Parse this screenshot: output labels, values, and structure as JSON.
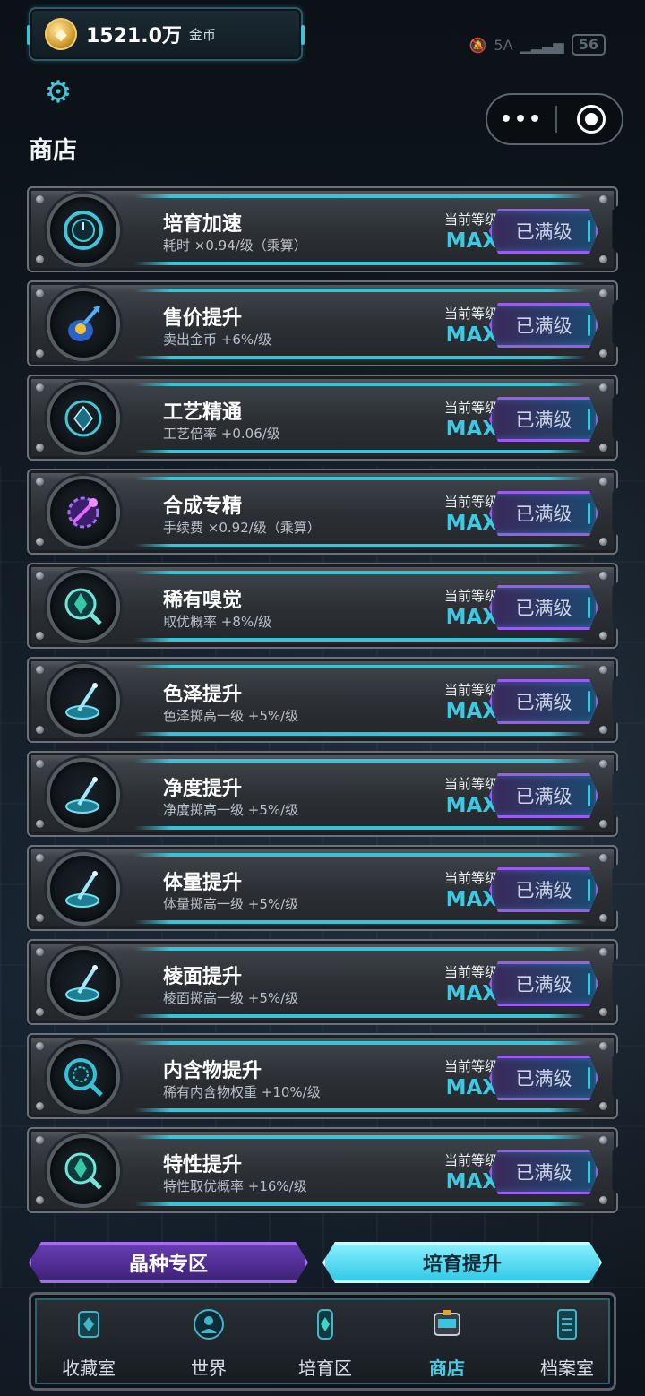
{
  "status_bar": {
    "coin_amount": "1521.0万",
    "coin_unit": "金币",
    "signal_label": "5A",
    "battery": "56"
  },
  "header": {
    "title": "商店"
  },
  "capsule": {
    "menu_glyph": "•••"
  },
  "level_label": "当前等级",
  "upgrades": [
    {
      "name": "培育加速",
      "desc": "耗时 ×0.94/级（乘算）",
      "level": "MAX",
      "button": "已满级",
      "icon": "timer-icon"
    },
    {
      "name": "售价提升",
      "desc": "卖出金币 +6%/级",
      "level": "MAX",
      "button": "已满级",
      "icon": "money-bag-icon"
    },
    {
      "name": "工艺精通",
      "desc": "工艺倍率 +0.06/级",
      "level": "MAX",
      "button": "已满级",
      "icon": "gem-craft-icon"
    },
    {
      "name": "合成专精",
      "desc": "手续费 ×0.92/级（乘算）",
      "level": "MAX",
      "button": "已满级",
      "icon": "synthesis-icon"
    },
    {
      "name": "稀有嗅觉",
      "desc": "取优概率 +8%/级",
      "level": "MAX",
      "button": "已满级",
      "icon": "crystal-magnifier-icon"
    },
    {
      "name": "色泽提升",
      "desc": "色泽掷高一级 +5%/级",
      "level": "MAX",
      "button": "已满级",
      "icon": "stylus-pad-icon"
    },
    {
      "name": "净度提升",
      "desc": "净度掷高一级 +5%/级",
      "level": "MAX",
      "button": "已满级",
      "icon": "stylus-pad-icon"
    },
    {
      "name": "体量提升",
      "desc": "体量掷高一级 +5%/级",
      "level": "MAX",
      "button": "已满级",
      "icon": "stylus-pad-icon"
    },
    {
      "name": "棱面提升",
      "desc": "棱面掷高一级 +5%/级",
      "level": "MAX",
      "button": "已满级",
      "icon": "stylus-pad-icon"
    },
    {
      "name": "内含物提升",
      "desc": "稀有内含物权重 +10%/级",
      "level": "MAX",
      "button": "已满级",
      "icon": "scan-magnifier-icon"
    },
    {
      "name": "特性提升",
      "desc": "特性取优概率 +16%/级",
      "level": "MAX",
      "button": "已满级",
      "icon": "crystal-magnifier-icon"
    }
  ],
  "tabs": {
    "left": "晶种专区",
    "right": "培育提升"
  },
  "nav": [
    {
      "label": "收藏室",
      "icon": "collection-icon",
      "active": false
    },
    {
      "label": "世界",
      "icon": "world-icon",
      "active": false
    },
    {
      "label": "培育区",
      "icon": "incubator-icon",
      "active": false
    },
    {
      "label": "商店",
      "icon": "shop-icon",
      "active": true
    },
    {
      "label": "档案室",
      "icon": "archive-icon",
      "active": false
    }
  ],
  "colors": {
    "accent_cyan": "#3bc9e4",
    "button_purple": "#9a5cf0",
    "coin_gold": "#d8a43a"
  }
}
